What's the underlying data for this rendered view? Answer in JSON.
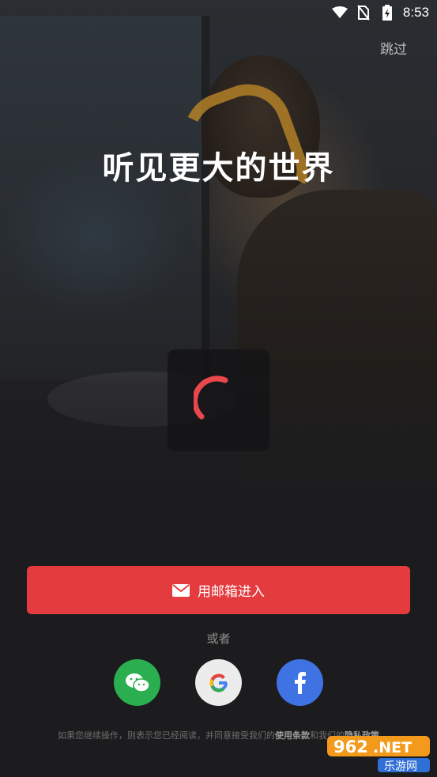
{
  "status_bar": {
    "time": "8:53"
  },
  "skip_label": "跳过",
  "headline": "听见更大的世界",
  "email_button": {
    "label": "用邮箱进入",
    "icon": "mail-icon"
  },
  "or_label": "或者",
  "social": [
    {
      "name": "wechat",
      "icon": "wechat-icon"
    },
    {
      "name": "google",
      "icon": "google-icon"
    },
    {
      "name": "facebook",
      "icon": "facebook-icon"
    }
  ],
  "terms": {
    "prefix": "如果您继续操作，则表示您已经阅读，并同意接受我们的",
    "terms_link": "使用条款",
    "middle": "和我们的",
    "privacy_link": "隐私政策"
  },
  "watermark": {
    "text_top": "962.NET",
    "text_bottom": "乐游网"
  },
  "colors": {
    "accent": "#e43b3f",
    "wechat": "#2aae4f",
    "facebook": "#3f73e3",
    "background": "#1c1c1e"
  }
}
